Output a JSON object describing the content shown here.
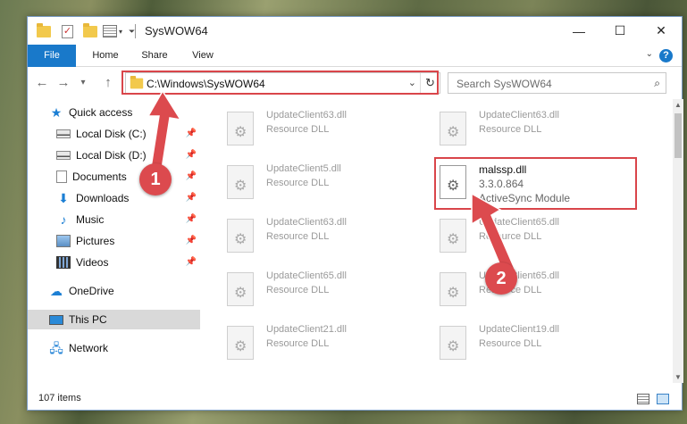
{
  "window": {
    "title": "SysWOW64",
    "controls": {
      "minimize": "—",
      "maximize": "☐",
      "close": "✕"
    }
  },
  "ribbon": {
    "tabs": [
      "File",
      "Home",
      "Share",
      "View"
    ],
    "help": "?",
    "accent": "#1979ca"
  },
  "navigation": {
    "back": "←",
    "forward": "→",
    "recent": "▾",
    "up": "↑",
    "address": "C:\\Windows\\SysWOW64",
    "refresh": "↻",
    "search_placeholder": "Search SysWOW64",
    "search_icon": "⌕"
  },
  "sidebar": {
    "items": [
      {
        "label": "Quick access",
        "icon": "star-icon",
        "pinned": false
      },
      {
        "label": "Local Disk (C:)",
        "icon": "disk-icon",
        "pinned": true
      },
      {
        "label": "Local Disk (D:)",
        "icon": "disk-icon",
        "pinned": true
      },
      {
        "label": "Documents",
        "icon": "documents-icon",
        "pinned": true
      },
      {
        "label": "Downloads",
        "icon": "download-icon",
        "pinned": true
      },
      {
        "label": "Music",
        "icon": "music-icon",
        "pinned": true
      },
      {
        "label": "Pictures",
        "icon": "pictures-icon",
        "pinned": true
      },
      {
        "label": "Videos",
        "icon": "videos-icon",
        "pinned": true
      },
      {
        "label": "OneDrive",
        "icon": "cloud-icon",
        "pinned": false
      },
      {
        "label": "This PC",
        "icon": "computer-icon",
        "pinned": false,
        "selected": true
      },
      {
        "label": "Network",
        "icon": "network-icon",
        "pinned": false
      }
    ]
  },
  "files": [
    {
      "name": "UpdateClient63.dll",
      "type": "Resource DLL"
    },
    {
      "name": "UpdateClient63.dll",
      "type": "Resource DLL"
    },
    {
      "name": "UpdateClient5.dll",
      "type": "Resource DLL"
    },
    {
      "name": "malssp.dll",
      "version": "3.3.0.864",
      "type": "ActiveSync Module",
      "highlighted": true
    },
    {
      "name": "UpdateClient63.dll",
      "type": "Resource DLL"
    },
    {
      "name": "UpdateClient65.dll",
      "type": "Resource DLL"
    },
    {
      "name": "UpdateClient65.dll",
      "type": "Resource DLL"
    },
    {
      "name": "UpdateClient65.dll",
      "type": "Resource DLL"
    },
    {
      "name": "UpdateClient21.dll",
      "type": "Resource DLL"
    },
    {
      "name": "UpdateClient19.dll",
      "type": "Resource DLL"
    }
  ],
  "status": {
    "item_count": "107 items"
  },
  "annotations": {
    "step1": "1",
    "step2": "2",
    "color": "#d9454a"
  }
}
